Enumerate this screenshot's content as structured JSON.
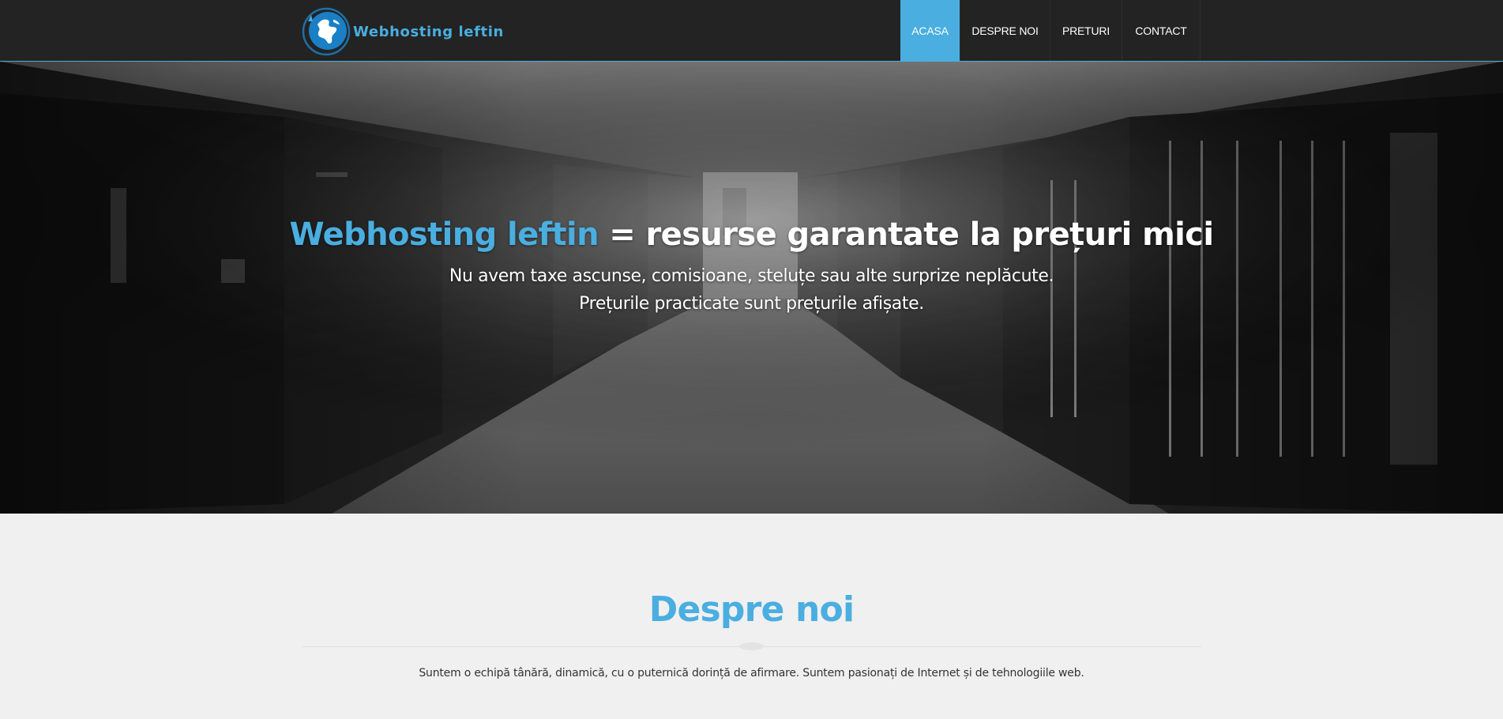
{
  "brand": {
    "name": "Webhosting leftin",
    "logo_icon": "globe-icon"
  },
  "nav": {
    "items": [
      {
        "label": "ACASA",
        "active": true
      },
      {
        "label": "DESPRE NOI",
        "active": false
      },
      {
        "label": "PRETURI",
        "active": false
      },
      {
        "label": "CONTACT",
        "active": false
      }
    ]
  },
  "hero": {
    "title_accent": "Webhosting leftin",
    "title_sep": " = ",
    "title_rest": "resurse garantate la prețuri mici",
    "line1": "Nu avem taxe ascunse, comisioane, steluțe sau alte surprize neplăcute.",
    "line2": "Prețurile practicate sunt prețurile afișate."
  },
  "about": {
    "title": "Despre noi",
    "text": "Suntem o echipă tânără, dinamică, cu o puternică dorință de afirmare. Suntem pasionați de Internet și de tehnologiile web."
  },
  "colors": {
    "accent": "#4aaee0",
    "navbar": "#232323",
    "page_bg": "#f0f0f0"
  }
}
